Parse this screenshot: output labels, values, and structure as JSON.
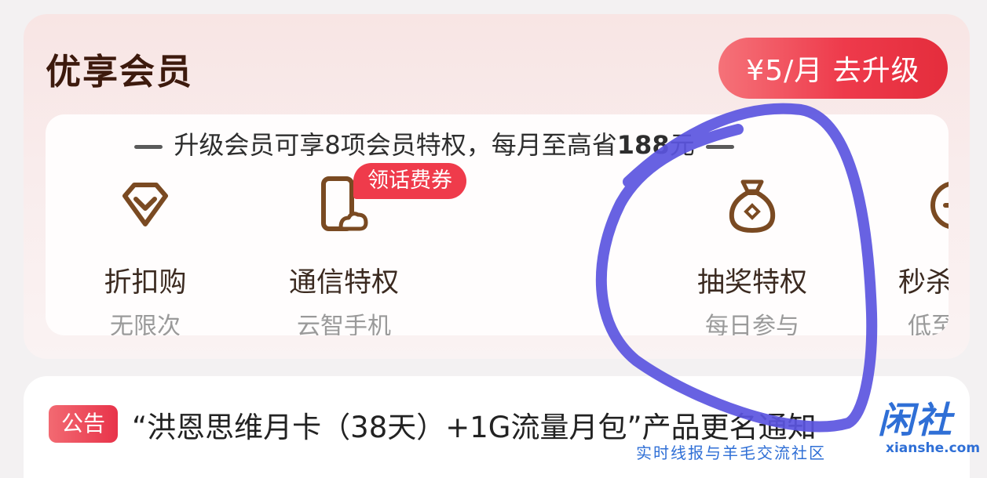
{
  "member": {
    "title": "优享会员",
    "upgrade_label": "¥5/月 去升级",
    "benefits_header_prefix": "升级会员可享8项会员特权，每月至高省",
    "benefits_header_amount": "188",
    "benefits_header_unit": "元",
    "coupon_tag": "领话费券",
    "benefits": [
      {
        "icon": "diamond-icon",
        "label": "折扣购",
        "sub": "无限次"
      },
      {
        "icon": "phone-cloud-icon",
        "label": "通信特权",
        "sub": "云智手机"
      },
      {
        "icon": "lucky-bag-icon",
        "label": "抽奖特权",
        "sub": "每日参与"
      },
      {
        "icon": "clock-icon",
        "label": "秒杀",
        "sub": "低至"
      }
    ]
  },
  "notice": {
    "badge": "公告",
    "text": "“洪恩思维月卡（38天）+1G流量月包”产品更名通知"
  },
  "watermark": {
    "logo": "闲社",
    "url": "xianshe.com",
    "caption": "实时线报与羊毛交流社区"
  },
  "colors": {
    "accent": "#ee3a4b",
    "title": "#3d1a0d",
    "icon_brown": "#7a4a22",
    "annotation": "#5b55e0",
    "watermark": "#2f6fd6"
  }
}
